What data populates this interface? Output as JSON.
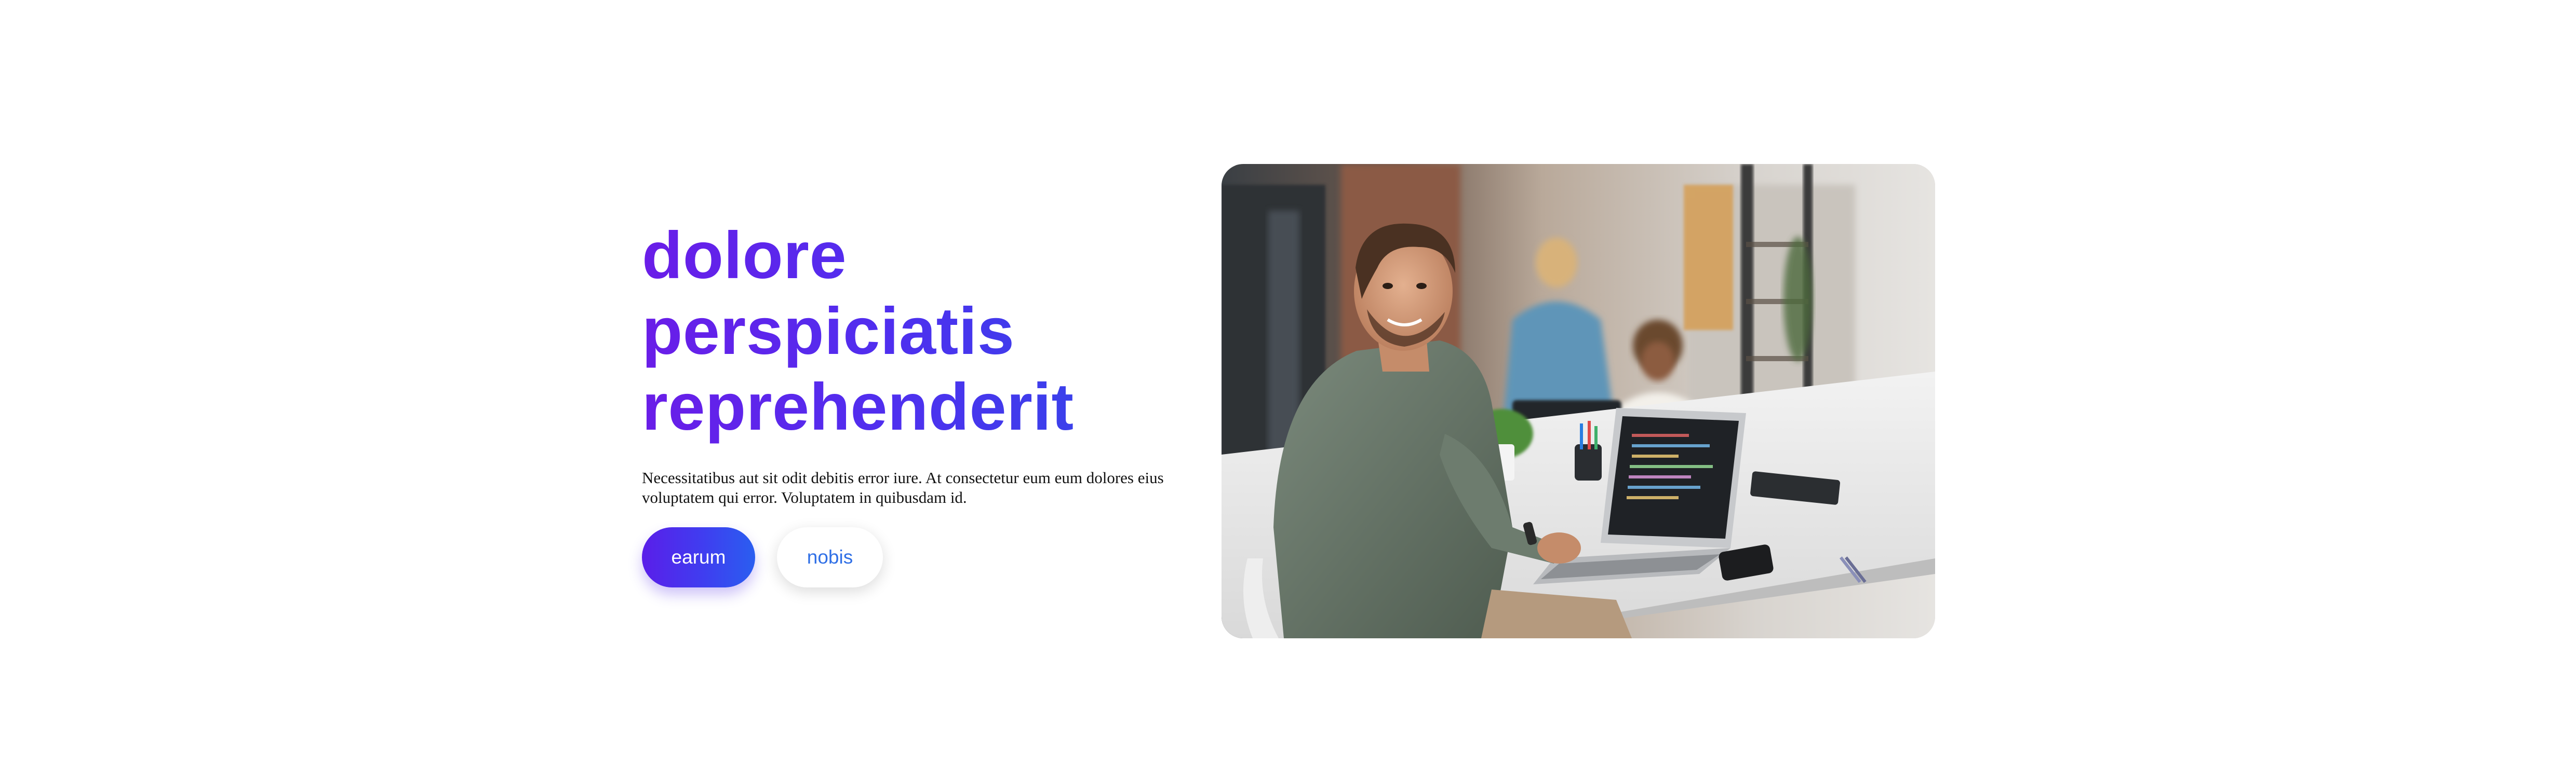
{
  "hero": {
    "headline": [
      "dolore",
      "perspiciatis",
      "reprehenderit"
    ],
    "description": "Necessitatibus aut sit odit debitis error iure. At consectetur eum eum dolores eius voluptatem qui error. Voluptatem in quibusdam id.",
    "primary_button": "earum",
    "secondary_button": "nobis",
    "image": {
      "subject": "office-scene-photo",
      "alt": ""
    }
  },
  "colors": {
    "headline_gradient_start": "#6a1de8",
    "headline_gradient_end": "#2e4be8",
    "primary_button_start": "#5a1ee9",
    "primary_button_end": "#2a5ef0",
    "secondary_button_text": "#2f6fe6",
    "body_text": "#111111",
    "background": "#ffffff"
  }
}
